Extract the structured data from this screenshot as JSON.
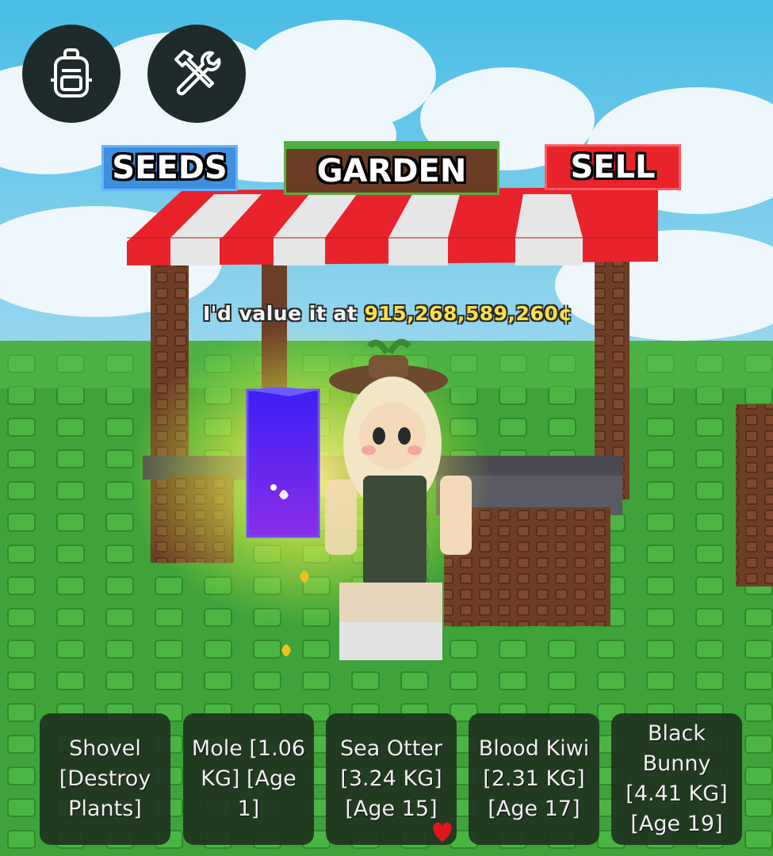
{
  "toolbar": {
    "backpack_icon": "backpack-icon",
    "tools_icon": "hammer-wrench-icon"
  },
  "nav": {
    "seeds_label": "SEEDS",
    "garden_label": "GARDEN",
    "sell_label": "SELL"
  },
  "npc": {
    "value_prefix": "I'd value it at ",
    "value_amount": "915,268,589,260¢"
  },
  "hotbar": {
    "slots": [
      {
        "label": "Shovel\n[Destroy\nPlants]",
        "favorited": false
      },
      {
        "label": "Mole [1.06\nKG] [Age\n1]",
        "favorited": false
      },
      {
        "label": "Sea Otter\n[3.24 KG]\n[Age 15]",
        "favorited": true
      },
      {
        "label": "Blood Kiwi\n[2.31 KG]\n[Age 17]",
        "favorited": false
      },
      {
        "label": "Black\nBunny\n[4.41 KG]\n[Age 19]",
        "favorited": false
      }
    ]
  },
  "colors": {
    "seeds": "#3f8fe0",
    "garden": "#6b3d24",
    "sell": "#e8232b",
    "value_amount": "#f6e04a",
    "slot_bg": "#1e2c1e",
    "heart": "#e3141e"
  }
}
